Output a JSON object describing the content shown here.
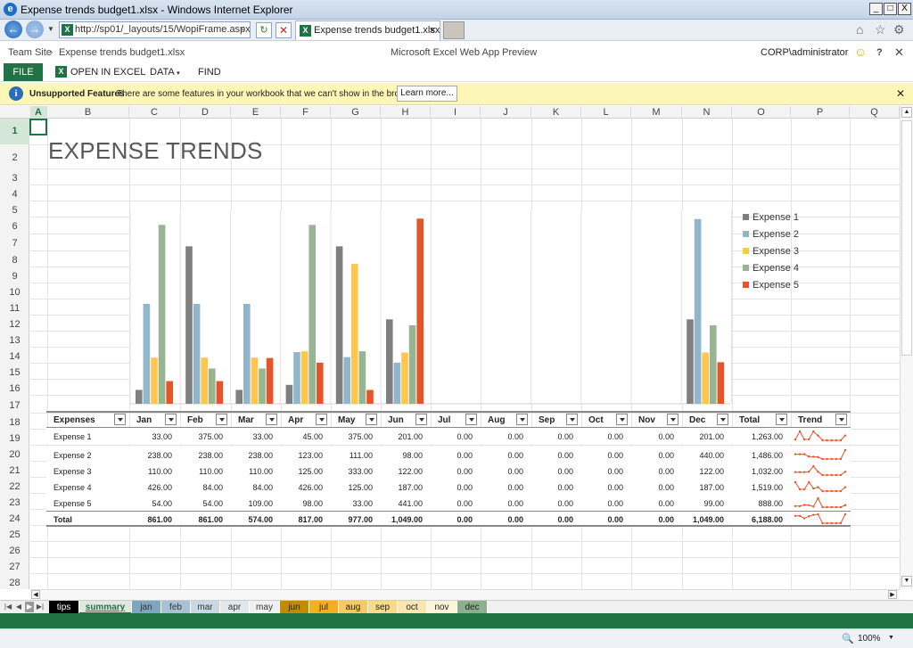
{
  "window": {
    "title": "Expense trends budget1.xlsx - Windows Internet Explorer",
    "minimize": "_",
    "maximize": "□",
    "close": "X"
  },
  "browser": {
    "address": "http://sp01/_layouts/15/WopiFrame.aspx",
    "tab_label": "Expense trends budget1.xlsx",
    "tab_close": "×",
    "zoom": "100%"
  },
  "sharepoint": {
    "breadcrumb_site": "Team Site",
    "breadcrumb_file": "Expense trends budget1.xlsx",
    "app_title": "Microsoft Excel Web App Preview",
    "user": "CORP\\administrator",
    "help": "?"
  },
  "ribbon": {
    "file": "FILE",
    "open_in_excel": "OPEN IN EXCEL",
    "data": "DATA",
    "find": "FIND"
  },
  "infobar": {
    "title": "Unsupported Features",
    "message": "There are some features in your workbook that we can't show in the browser.",
    "learn_more": "Learn more..."
  },
  "grid": {
    "name_box": "A",
    "columns": [
      "A",
      "B",
      "C",
      "D",
      "E",
      "F",
      "G",
      "H",
      "I",
      "J",
      "K",
      "L",
      "M",
      "N",
      "O",
      "P",
      "Q"
    ],
    "rows": [
      "1",
      "2",
      "3",
      "4",
      "5",
      "6",
      "7",
      "8",
      "9",
      "10",
      "11",
      "12",
      "13",
      "14",
      "15",
      "16",
      "17",
      "18",
      "19",
      "20",
      "21",
      "22",
      "23",
      "24",
      "25",
      "26",
      "27",
      "28"
    ]
  },
  "sheet_title": "EXPENSE TRENDS",
  "table": {
    "headers": [
      "Expenses",
      "Jan",
      "Feb",
      "Mar",
      "Apr",
      "May",
      "Jun",
      "Jul",
      "Aug",
      "Sep",
      "Oct",
      "Nov",
      "Dec",
      "Total",
      "Trend"
    ],
    "rows": [
      {
        "label": "Expense 1",
        "values": [
          "33.00",
          "375.00",
          "33.00",
          "45.00",
          "375.00",
          "201.00",
          "0.00",
          "0.00",
          "0.00",
          "0.00",
          "0.00",
          "201.00",
          "1,263.00"
        ]
      },
      {
        "label": "Expense 2",
        "values": [
          "238.00",
          "238.00",
          "238.00",
          "123.00",
          "111.00",
          "98.00",
          "0.00",
          "0.00",
          "0.00",
          "0.00",
          "0.00",
          "440.00",
          "1,486.00"
        ]
      },
      {
        "label": "Expense 3",
        "values": [
          "110.00",
          "110.00",
          "110.00",
          "125.00",
          "333.00",
          "122.00",
          "0.00",
          "0.00",
          "0.00",
          "0.00",
          "0.00",
          "122.00",
          "1,032.00"
        ]
      },
      {
        "label": "Expense 4",
        "values": [
          "426.00",
          "84.00",
          "84.00",
          "426.00",
          "125.00",
          "187.00",
          "0.00",
          "0.00",
          "0.00",
          "0.00",
          "0.00",
          "187.00",
          "1,519.00"
        ]
      },
      {
        "label": "Expense 5",
        "values": [
          "54.00",
          "54.00",
          "109.00",
          "98.00",
          "33.00",
          "441.00",
          "0.00",
          "0.00",
          "0.00",
          "0.00",
          "0.00",
          "99.00",
          "888.00"
        ]
      }
    ],
    "total": {
      "label": "Total",
      "values": [
        "861.00",
        "861.00",
        "574.00",
        "817.00",
        "977.00",
        "1,049.00",
        "0.00",
        "0.00",
        "0.00",
        "0.00",
        "0.00",
        "1,049.00",
        "6,188.00"
      ]
    }
  },
  "chart_data": {
    "type": "bar",
    "categories": [
      "Jan",
      "Feb",
      "Mar",
      "Apr",
      "May",
      "Jun",
      "Jul",
      "Aug",
      "Sep",
      "Oct",
      "Nov",
      "Dec"
    ],
    "series": [
      {
        "name": "Expense 1",
        "color": "#7f7f7f",
        "values": [
          33,
          375,
          33,
          45,
          375,
          201,
          0,
          0,
          0,
          0,
          0,
          201
        ]
      },
      {
        "name": "Expense 2",
        "color": "#91b5c9",
        "values": [
          238,
          238,
          238,
          123,
          111,
          98,
          0,
          0,
          0,
          0,
          0,
          440
        ]
      },
      {
        "name": "Expense 3",
        "color": "#fdc64d",
        "values": [
          110,
          110,
          110,
          125,
          333,
          122,
          0,
          0,
          0,
          0,
          0,
          122
        ]
      },
      {
        "name": "Expense 4",
        "color": "#97b592",
        "values": [
          426,
          84,
          84,
          426,
          125,
          187,
          0,
          0,
          0,
          0,
          0,
          187
        ]
      },
      {
        "name": "Expense 5",
        "color": "#e65529",
        "values": [
          54,
          54,
          109,
          98,
          33,
          441,
          0,
          0,
          0,
          0,
          0,
          99
        ]
      }
    ],
    "ylim": [
      0,
      450
    ],
    "legend": "right",
    "grid": false
  },
  "sheet_tabs": [
    {
      "label": "tips",
      "bg": "#000000",
      "fg": "#ffffff"
    },
    {
      "label": "summary",
      "bg": "#dfe7df",
      "fg": "#217346",
      "active": true
    },
    {
      "label": "jan",
      "bg": "#7fa6bf",
      "fg": "#333333"
    },
    {
      "label": "feb",
      "bg": "#a7c2d3",
      "fg": "#333333"
    },
    {
      "label": "mar",
      "bg": "#c9d8e2",
      "fg": "#333333"
    },
    {
      "label": "apr",
      "bg": "#e0e8ee",
      "fg": "#333333"
    },
    {
      "label": "may",
      "bg": "#f0f0f0",
      "fg": "#333333"
    },
    {
      "label": "jun",
      "bg": "#c08c00",
      "fg": "#222222"
    },
    {
      "label": "jul",
      "bg": "#f2b01e",
      "fg": "#222222"
    },
    {
      "label": "aug",
      "bg": "#f7c966",
      "fg": "#222222"
    },
    {
      "label": "sep",
      "bg": "#f9d98c",
      "fg": "#222222"
    },
    {
      "label": "oct",
      "bg": "#fbe6b2",
      "fg": "#222222"
    },
    {
      "label": "nov",
      "bg": "#fdf3d9",
      "fg": "#222222"
    },
    {
      "label": "dec",
      "bg": "#8cb08c",
      "fg": "#222222"
    }
  ]
}
